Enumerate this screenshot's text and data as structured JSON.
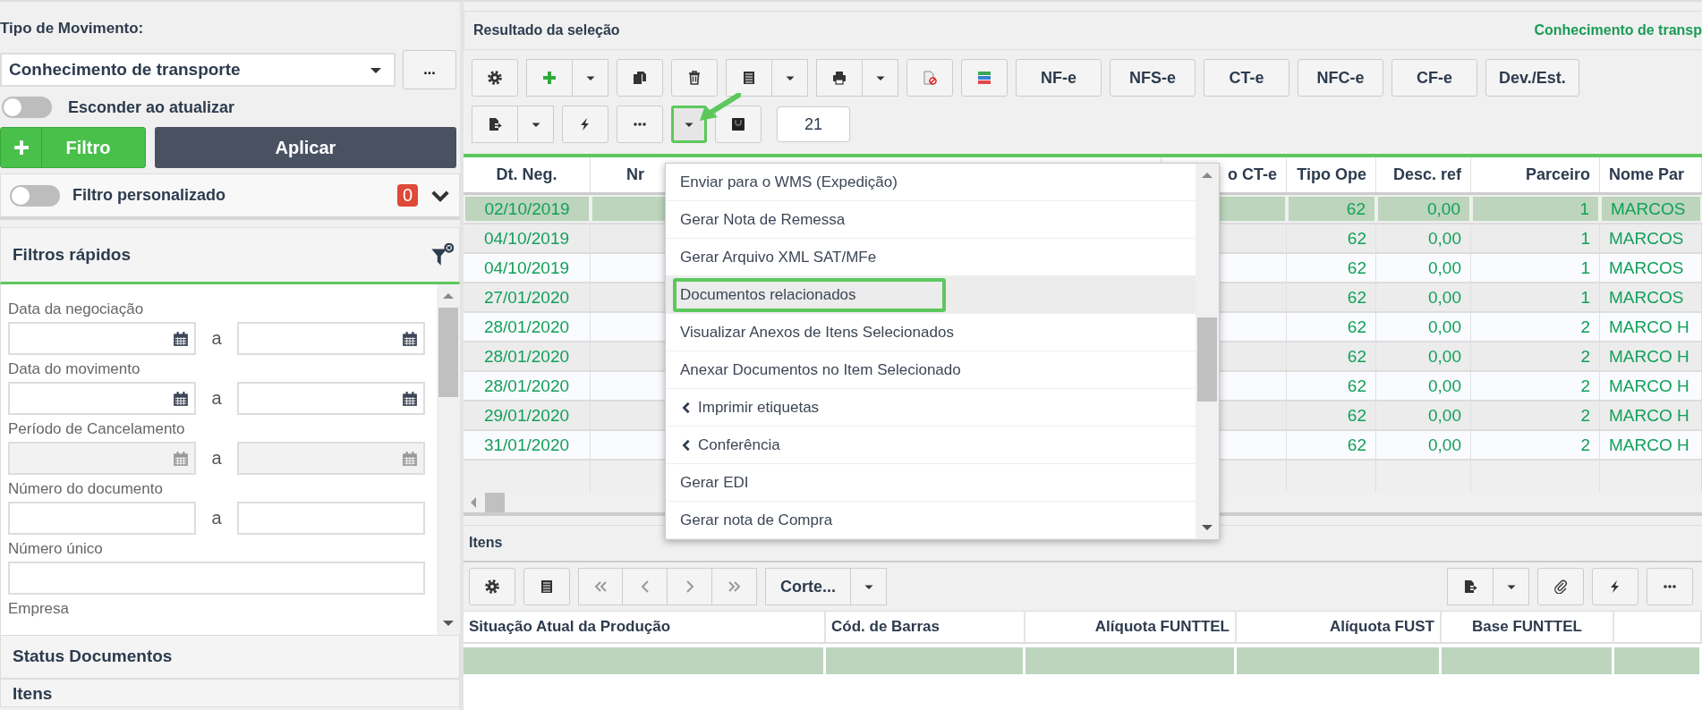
{
  "sidebar": {
    "movement_type": {
      "label": "Tipo de Movimento:",
      "value": "Conhecimento de transporte",
      "more_button": "..."
    },
    "hide_on_refresh": {
      "label": "Esconder ao atualizar",
      "on": false
    },
    "filter_button": "Filtro",
    "apply_button": "Aplicar",
    "custom_filter": {
      "label": "Filtro personalizado",
      "on": false,
      "count": "0"
    },
    "quick_filters": {
      "title": "Filtros rápidos",
      "fields": [
        {
          "label": "Data da negociação",
          "kind": "date_range",
          "separator": "a",
          "disabled": false
        },
        {
          "label": "Data do movimento",
          "kind": "date_range",
          "separator": "a",
          "disabled": false
        },
        {
          "label": "Período de Cancelamento",
          "kind": "date_range",
          "separator": "a",
          "disabled": true
        },
        {
          "label": "Número do documento",
          "kind": "range",
          "separator": "a",
          "disabled": false
        },
        {
          "label": "Número único",
          "kind": "text",
          "disabled": false
        },
        {
          "label": "Empresa",
          "kind": "label"
        }
      ]
    },
    "sections": [
      "Status Documentos",
      "Itens"
    ]
  },
  "results": {
    "title": "Resultado da seleção",
    "context": "Conhecimento de transp",
    "text_buttons": [
      "NF-e",
      "NFS-e",
      "CT-e",
      "NFC-e",
      "CF-e",
      "Dev./Est."
    ],
    "record_count": "21",
    "columns": [
      "Dt. Neg.",
      "Nr",
      "o CT-e",
      "Tipo Ope",
      "Desc. ref",
      "Parceiro",
      "Nome Par"
    ],
    "rows": [
      {
        "dt_neg": "02/10/2019",
        "tipo_ope": "62",
        "desc_ref": "0,00",
        "parceiro": "1",
        "nome_parceiro": "MARCOS",
        "selected": true
      },
      {
        "dt_neg": "04/10/2019",
        "tipo_ope": "62",
        "desc_ref": "0,00",
        "parceiro": "1",
        "nome_parceiro": "MARCOS",
        "selected": false
      },
      {
        "dt_neg": "04/10/2019",
        "tipo_ope": "62",
        "desc_ref": "0,00",
        "parceiro": "1",
        "nome_parceiro": "MARCOS",
        "selected": false
      },
      {
        "dt_neg": "27/01/2020",
        "tipo_ope": "62",
        "desc_ref": "0,00",
        "parceiro": "1",
        "nome_parceiro": "MARCOS",
        "selected": false
      },
      {
        "dt_neg": "28/01/2020",
        "tipo_ope": "62",
        "desc_ref": "0,00",
        "parceiro": "2",
        "nome_parceiro": "MARCO H",
        "selected": false
      },
      {
        "dt_neg": "28/01/2020",
        "tipo_ope": "62",
        "desc_ref": "0,00",
        "parceiro": "2",
        "nome_parceiro": "MARCO H",
        "selected": false
      },
      {
        "dt_neg": "28/01/2020",
        "tipo_ope": "62",
        "desc_ref": "0,00",
        "parceiro": "2",
        "nome_parceiro": "MARCO H",
        "selected": false
      },
      {
        "dt_neg": "29/01/2020",
        "tipo_ope": "62",
        "desc_ref": "0,00",
        "parceiro": "2",
        "nome_parceiro": "MARCO H",
        "selected": false
      },
      {
        "dt_neg": "31/01/2020",
        "tipo_ope": "62",
        "desc_ref": "0,00",
        "parceiro": "2",
        "nome_parceiro": "MARCO H",
        "selected": false
      }
    ],
    "actions_menu": {
      "open": true,
      "annotated": true,
      "items": [
        {
          "label": "Enviar para o WMS (Expedição)",
          "kind": "action",
          "hovered": false,
          "annotated": false
        },
        {
          "label": "Gerar Nota de Remessa",
          "kind": "action",
          "hovered": false,
          "annotated": false
        },
        {
          "label": "Gerar Arquivo XML SAT/MFe",
          "kind": "action",
          "hovered": false,
          "annotated": false
        },
        {
          "label": "Documentos relacionados",
          "kind": "action",
          "hovered": true,
          "annotated": true
        },
        {
          "label": "Visualizar Anexos de Itens Selecionados",
          "kind": "action",
          "hovered": false,
          "annotated": false
        },
        {
          "label": "Anexar Documentos no Item Selecionado",
          "kind": "action",
          "hovered": false,
          "annotated": false
        },
        {
          "label": "Imprimir etiquetas",
          "kind": "submenu",
          "hovered": false,
          "annotated": false
        },
        {
          "label": "Conferência",
          "kind": "submenu",
          "hovered": false,
          "annotated": false
        },
        {
          "label": "Gerar EDI",
          "kind": "action",
          "hovered": false,
          "annotated": false
        },
        {
          "label": "Gerar nota de Compra",
          "kind": "action",
          "hovered": false,
          "annotated": false
        }
      ]
    }
  },
  "items": {
    "title": "Itens",
    "cut_button": "Corte...",
    "columns": [
      "Situação Atual da Produção",
      "Cód. de Barras",
      "Alíquota FUNTTEL",
      "Alíquota FUST",
      "Base FUNTTEL"
    ],
    "rows": [
      {
        "selected": true
      }
    ]
  }
}
